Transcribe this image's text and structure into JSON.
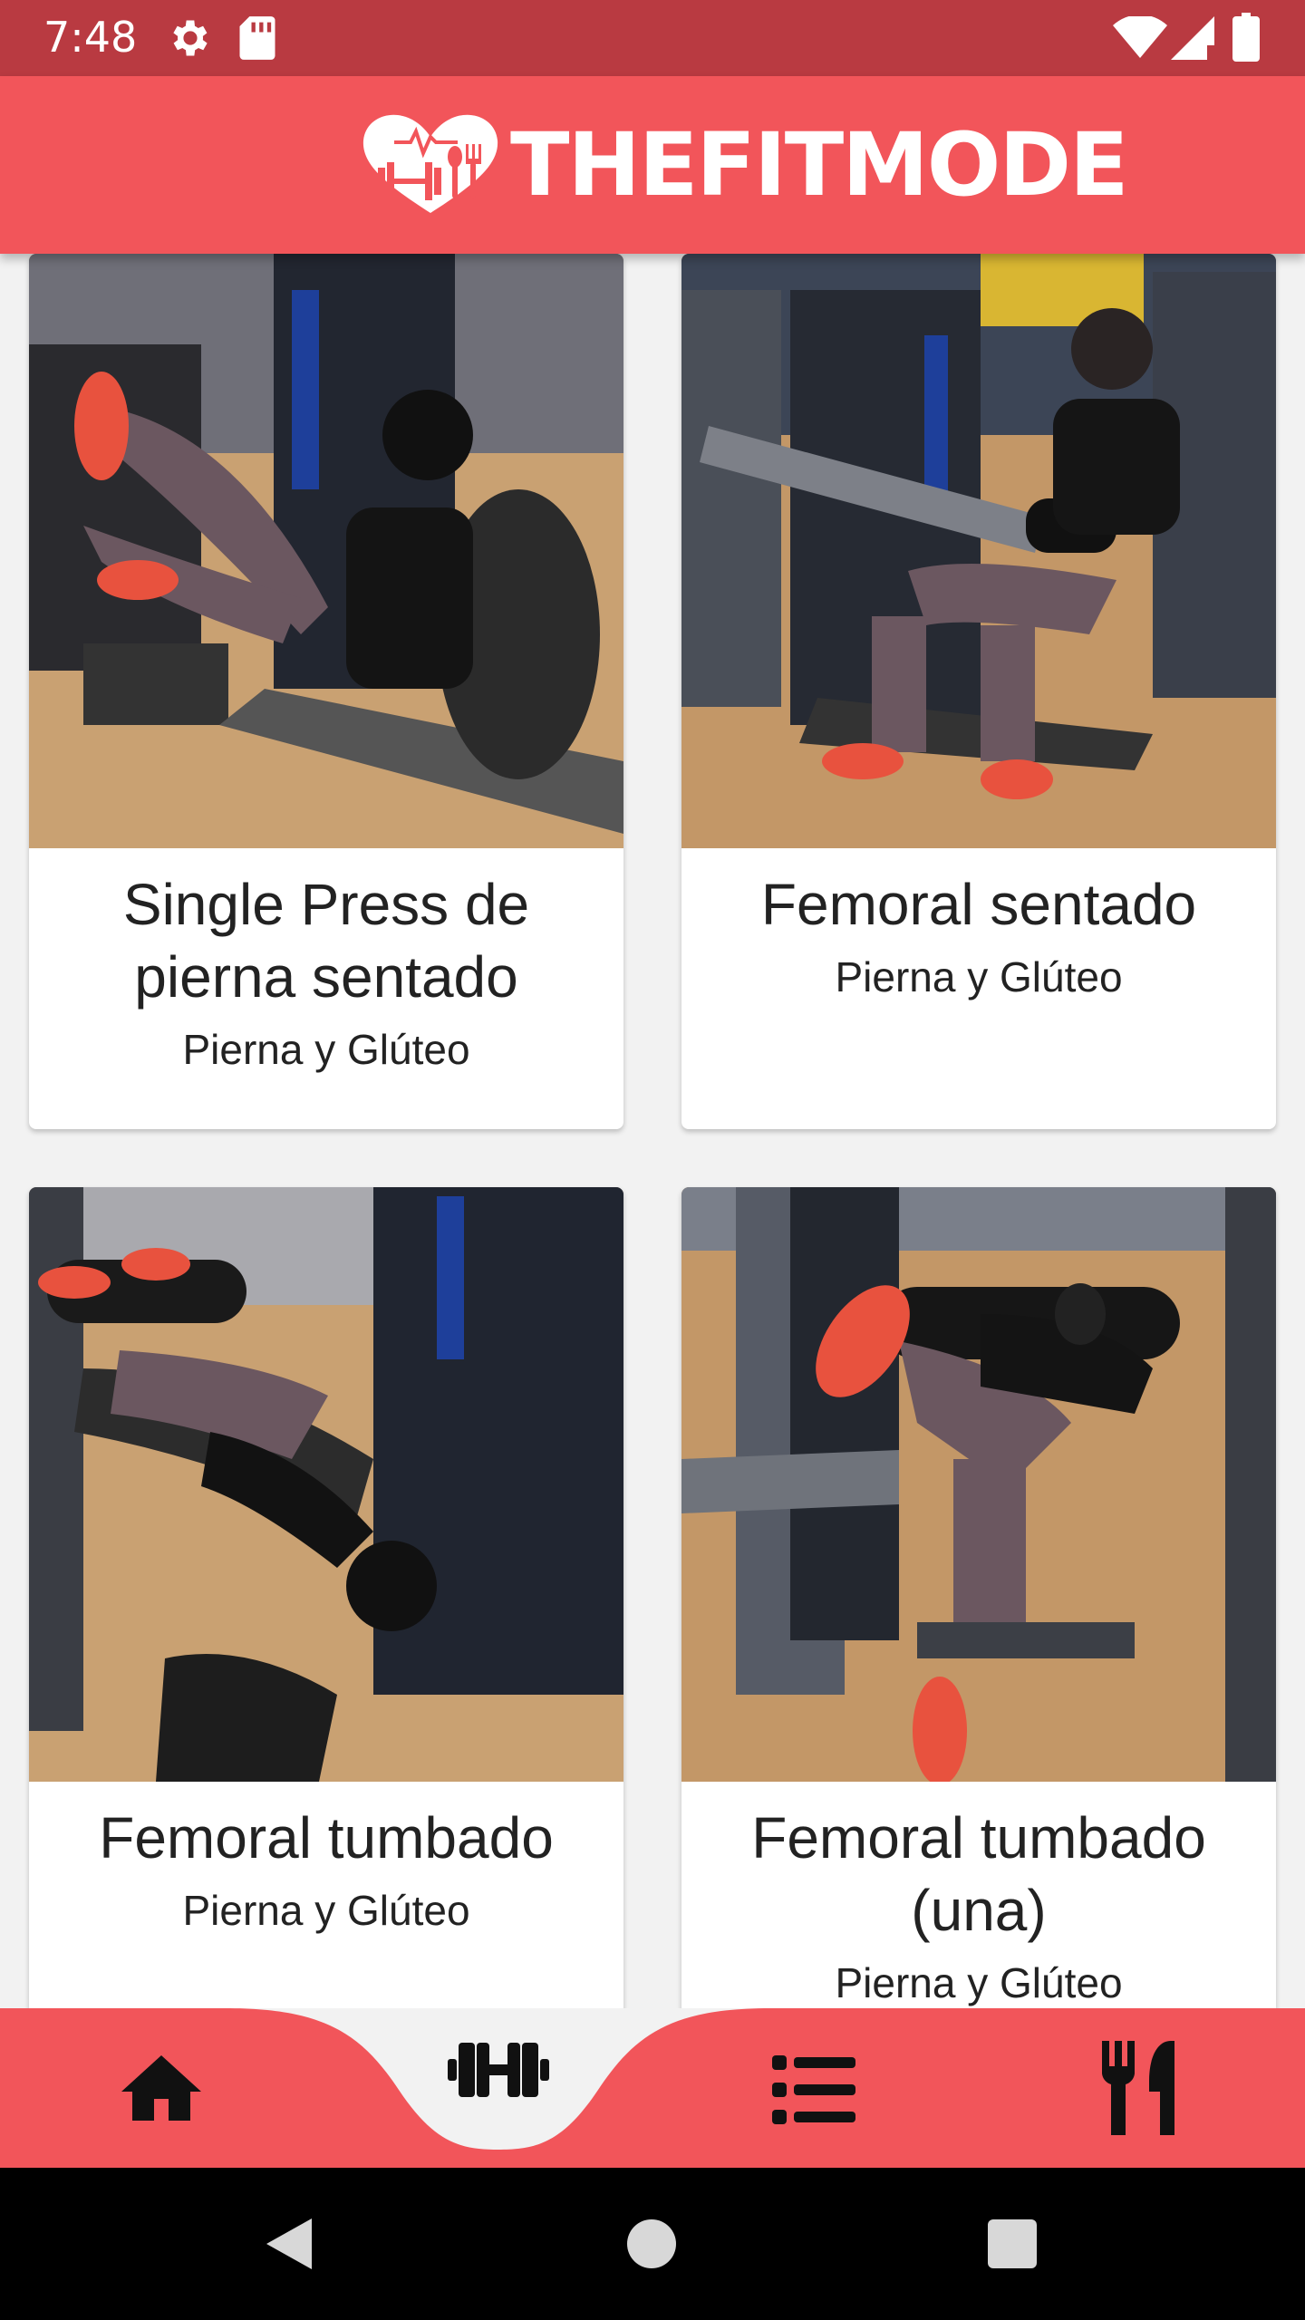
{
  "status_bar": {
    "time": "7:48",
    "icons": [
      "settings-icon",
      "sd-card-icon",
      "wifi-icon",
      "signal-icon",
      "battery-icon"
    ]
  },
  "header": {
    "logo_text": "THEFITMODE",
    "logo_icons": [
      "dumbbell-icon",
      "heart-pulse-icon",
      "fork-spoon-icon"
    ]
  },
  "colors": {
    "brand": "#f2555a",
    "status_bar": "#b93a41",
    "nav_icons": "#111111",
    "background": "#f2f2f2"
  },
  "exercises": [
    {
      "title": "Single Press de pierna sentado",
      "category": "Pierna y Glúteo",
      "image": "woman on seated leg press machine"
    },
    {
      "title": "Femoral sentado",
      "category": "Pierna y Glúteo",
      "image": "woman on seated leg curl machine"
    },
    {
      "title": "Femoral tumbado",
      "category": "Pierna y Glúteo",
      "image": "woman on lying leg curl machine"
    },
    {
      "title": "Femoral tumbado (una)",
      "category": "Pierna y Glúteo",
      "image": "woman on single lying leg curl machine"
    }
  ],
  "bottom_nav": {
    "items": [
      {
        "name": "home",
        "icon": "home-icon",
        "selected": false
      },
      {
        "name": "workouts",
        "icon": "dumbbell-icon",
        "selected": true
      },
      {
        "name": "list",
        "icon": "list-icon",
        "selected": false
      },
      {
        "name": "nutrition",
        "icon": "fork-knife-icon",
        "selected": false
      }
    ]
  },
  "system_nav": [
    "back-icon",
    "home-circle-icon",
    "recents-icon"
  ]
}
